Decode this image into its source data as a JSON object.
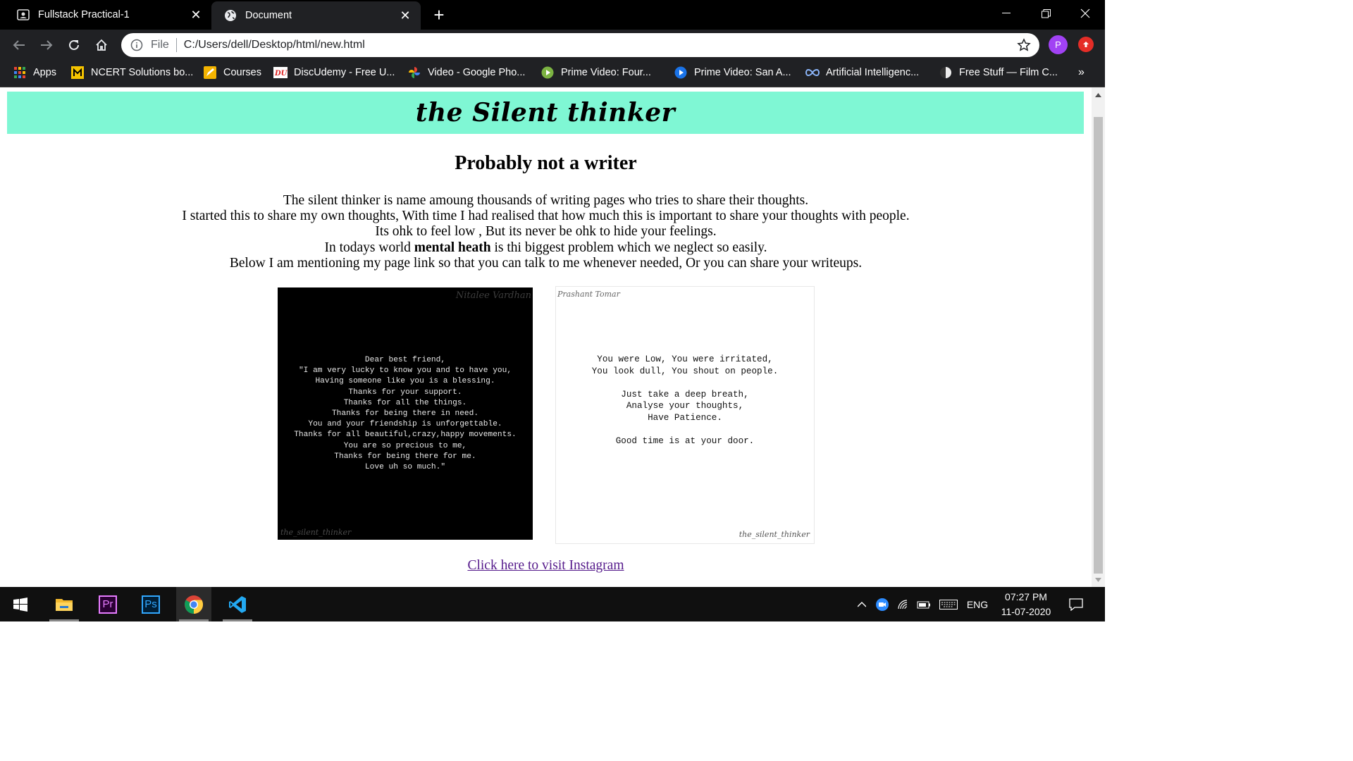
{
  "browser": {
    "tabs": [
      {
        "title": "Fullstack Practical-1",
        "icon": "profile-card-icon",
        "active": false
      },
      {
        "title": "Document",
        "icon": "globe-icon",
        "active": true
      }
    ],
    "omnibox": {
      "scheme_label": "File",
      "url": "C:/Users/dell/Desktop/html/new.html"
    },
    "profile_initial": "P",
    "bookmarks": [
      {
        "label": "Apps",
        "icon": "apps-grid-icon"
      },
      {
        "label": "NCERT Solutions bo...",
        "icon": "ncert-icon"
      },
      {
        "label": "Courses",
        "icon": "pencil-icon"
      },
      {
        "label": "DiscUdemy - Free U...",
        "icon": "discudemy-icon"
      },
      {
        "label": "Video - Google Pho...",
        "icon": "google-photos-icon"
      },
      {
        "label": "Prime Video: Four...",
        "icon": "play-icon"
      },
      {
        "label": "Prime Video: San A...",
        "icon": "play-icon"
      },
      {
        "label": "Artificial Intelligenc...",
        "icon": "infinity-icon"
      },
      {
        "label": "Free Stuff — Film C...",
        "icon": "half-moon-icon"
      }
    ],
    "bookmarks_overflow": "»"
  },
  "page": {
    "logo": "the Silent thinker",
    "heading": "Probably not a writer",
    "paragraph": {
      "line1": "The silent thinker is name amoung thousands of writing pages who tries to share their thoughts.",
      "line2": "I started this to share my own thoughts, With time I had realised that how much this is important to share your thoughts with people.",
      "line3": "Its ohk to feel low , But its never be ohk to hide your feelings.",
      "line4_pre": "In todays world ",
      "line4_bold": "mental heath",
      "line4_post": " is thi biggest problem which we neglect so easily.",
      "line5": "Below I am mentioning my page link so that you can talk to me whenever needed, Or you can share your writeups."
    },
    "image1": {
      "quote": "Dear best friend,\n\"I am very lucky to know you and to have you,\nHaving someone like you is a blessing.\nThanks for your support.\nThanks for all the things.\nThanks for being there in need.\nYou and your friendship is unforgettable.\nThanks for all beautiful,crazy,happy movements.\nYou are so precious to me,\nThanks for being there for me.\nLove uh so much.\"",
      "signature_top": "Nitalee Vardhan",
      "signature_bottom": "the_silent_thinker"
    },
    "image2": {
      "quote": "You were Low, You were irritated,\nYou look dull, You shout on people.\n\nJust take a deep breath,\nAnalyse your thoughts,\nHave Patience.\n\nGood time is at your door.",
      "signature_top": "Prashant Tomar",
      "signature_bottom": "the_silent_thinker"
    },
    "link_text": "Click here to visit Instagram"
  },
  "taskbar": {
    "apps": [
      "windows-start-icon",
      "file-explorer-icon",
      "premiere-pro-icon",
      "photoshop-icon",
      "chrome-icon",
      "vscode-icon"
    ],
    "premiere_label": "Pr",
    "photoshop_label": "Ps",
    "language": "ENG",
    "time": "07:27 PM",
    "date": "11-07-2020"
  },
  "colors": {
    "header_band": "#7ff7d4",
    "link_visited": "#551a8b",
    "chrome_dark": "#202124"
  }
}
